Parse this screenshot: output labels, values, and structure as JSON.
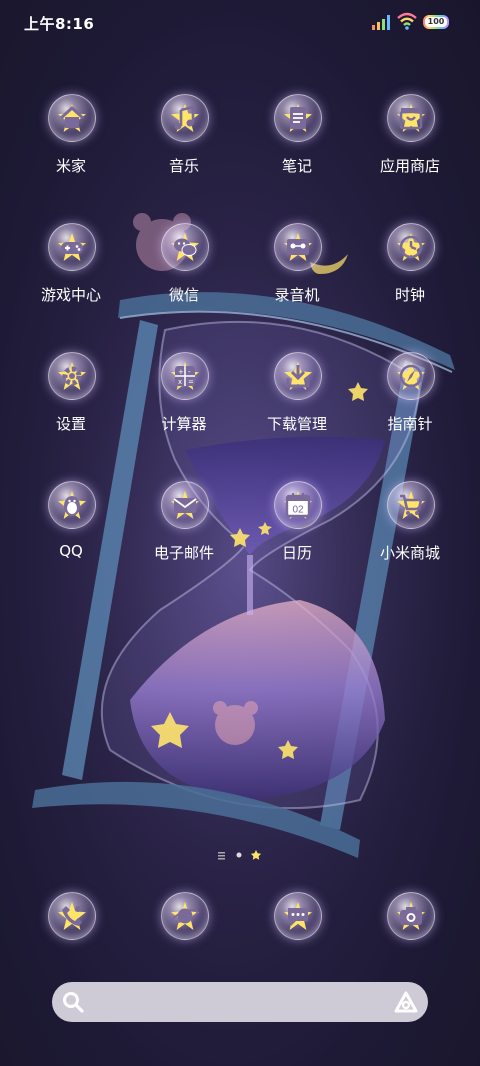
{
  "status": {
    "time": "上午8:16",
    "battery": "100"
  },
  "apps": [
    {
      "label": "米家",
      "icon": "home-icon"
    },
    {
      "label": "音乐",
      "icon": "music-note-icon"
    },
    {
      "label": "笔记",
      "icon": "notes-icon"
    },
    {
      "label": "应用商店",
      "icon": "app-store-bag-icon"
    },
    {
      "label": "游戏中心",
      "icon": "gamepad-icon"
    },
    {
      "label": "微信",
      "icon": "wechat-icon"
    },
    {
      "label": "录音机",
      "icon": "cassette-icon"
    },
    {
      "label": "时钟",
      "icon": "clock-icon"
    },
    {
      "label": "设置",
      "icon": "gear-icon"
    },
    {
      "label": "计算器",
      "icon": "calculator-icon"
    },
    {
      "label": "下载管理",
      "icon": "download-icon"
    },
    {
      "label": "指南针",
      "icon": "compass-icon"
    },
    {
      "label": "QQ",
      "icon": "penguin-icon"
    },
    {
      "label": "电子邮件",
      "icon": "envelope-icon"
    },
    {
      "label": "日历",
      "icon": "calendar-icon",
      "date": "02"
    },
    {
      "label": "小米商城",
      "icon": "shopping-cart-icon"
    }
  ],
  "dock": [
    {
      "icon": "phone-icon"
    },
    {
      "icon": "planet-browser-icon"
    },
    {
      "icon": "message-icon"
    },
    {
      "icon": "camera-icon"
    }
  ],
  "colors": {
    "icon_glyph": "#7a6a9a",
    "background": "#2a2347",
    "search_bar": "#cfcbd6",
    "star": "#ffe46a"
  }
}
